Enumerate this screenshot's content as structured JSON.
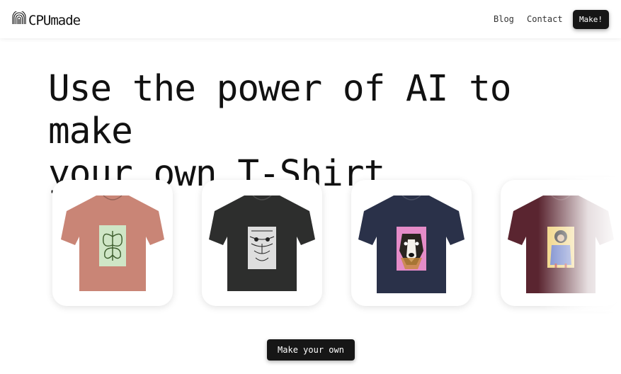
{
  "brand": {
    "name": "CPUmade",
    "icon": "fingerprint-logo-icon"
  },
  "nav": {
    "links": [
      {
        "label": "Blog"
      },
      {
        "label": "Contact"
      }
    ],
    "make_label": "Make!"
  },
  "hero": {
    "line1": "Use the power of AI to make",
    "line2": "your own T-Shirt"
  },
  "carousel": {
    "items": [
      {
        "shirt_color": "#c98576",
        "art": "butterfly",
        "art_bg": "#cfe6c6"
      },
      {
        "shirt_color": "#2d2e2d",
        "art": "tiger",
        "art_bg": "#dedede"
      },
      {
        "shirt_color": "#2a3149",
        "art": "dog",
        "art_bg": "#e58cc8"
      },
      {
        "shirt_color": "#5a2530",
        "art": "monkey",
        "art_bg": "#f0d27a"
      }
    ]
  },
  "cta": {
    "label": "Make your own"
  },
  "colors": {
    "button_bg": "#161616",
    "text": "#111111"
  }
}
